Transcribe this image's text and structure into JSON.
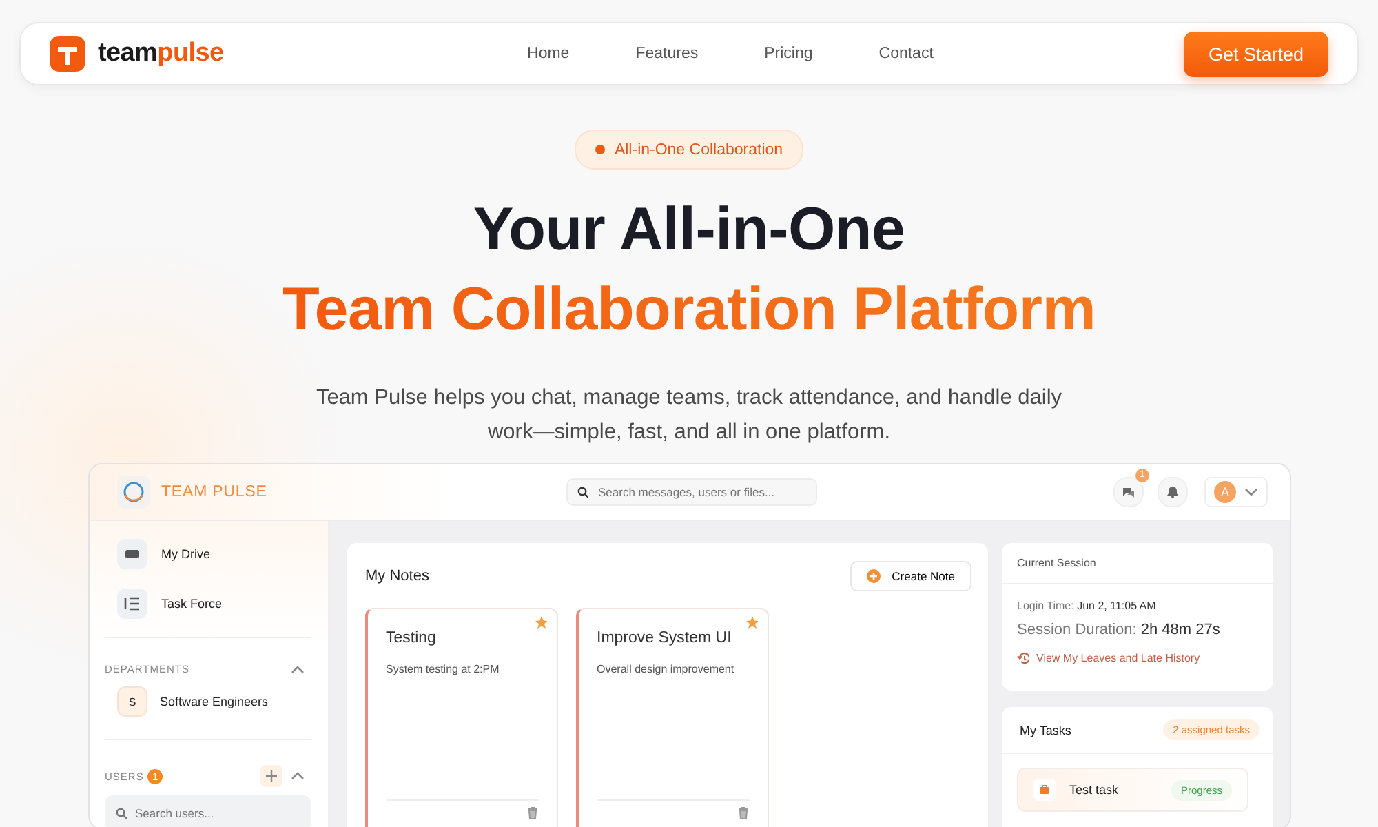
{
  "nav": {
    "brand": {
      "first": "team",
      "second": "pulse"
    },
    "links": [
      {
        "label": "Home"
      },
      {
        "label": "Features"
      },
      {
        "label": "Pricing"
      },
      {
        "label": "Contact"
      }
    ],
    "cta": "Get Started"
  },
  "hero": {
    "badge": "All-in-One Collaboration",
    "title_line_1": "Your All-in-One",
    "title_line_2": "Team Collaboration Platform",
    "subtitle": "Team Pulse helps you chat, manage teams, track attendance, and handle daily work—simple, fast, and all in one platform."
  },
  "app": {
    "brand": "TEAM PULSE",
    "search": {
      "placeholder": "Search messages, users or files..."
    },
    "message_count": "1",
    "avatar": "A",
    "sidebar": {
      "items": [
        {
          "label": "My Drive",
          "kind": "drive"
        },
        {
          "label": "Task Force",
          "kind": "list"
        }
      ],
      "departments": {
        "title": "DEPARTMENTS",
        "expanded": true,
        "items": [
          {
            "initial": "S",
            "label": "Software Engineers"
          }
        ]
      },
      "users": {
        "title": "USERS",
        "count": "1",
        "expanded": true,
        "search": {
          "placeholder": "Search users..."
        }
      }
    },
    "notes": {
      "title": "My Notes",
      "create_button": "Create Note",
      "items": [
        {
          "title": "Testing",
          "body": "System testing at 2:PM",
          "pinned": true
        },
        {
          "title": "Improve System UI",
          "body": "Overall design improvement",
          "pinned": true
        }
      ]
    },
    "session": {
      "title": "Current Session",
      "login_label": "Login Time:",
      "login_value": "Jun 2, 11:05 AM",
      "duration_label": "Session Duration:",
      "duration_value": "2h 48m 27s",
      "history_link": "View My Leaves and Late History"
    },
    "tasks": {
      "title": "My Tasks",
      "badge": "2 assigned tasks",
      "items": [
        {
          "title": "Test task",
          "status": "Progress"
        }
      ]
    }
  }
}
